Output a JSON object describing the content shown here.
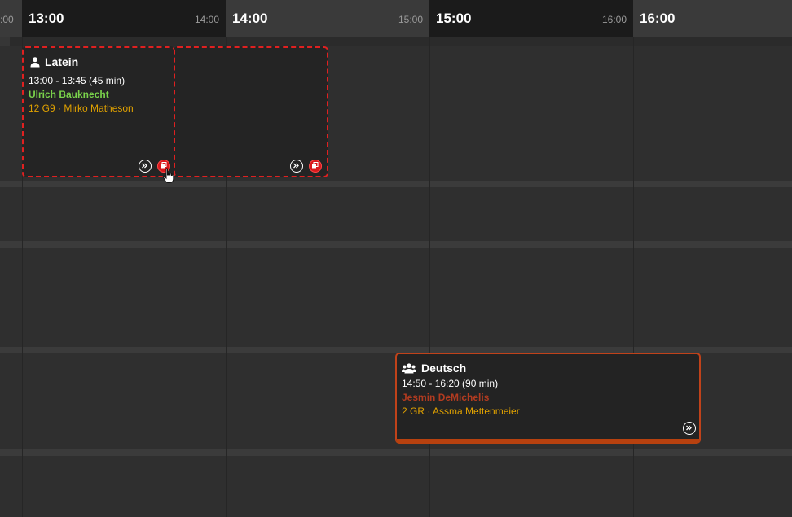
{
  "header": {
    "prev_end": ":00",
    "slots": [
      {
        "start": "13:00",
        "end": "14:00"
      },
      {
        "start": "14:00",
        "end": "15:00"
      },
      {
        "start": "15:00",
        "end": "16:00"
      },
      {
        "start": "16:00",
        "end": ""
      }
    ]
  },
  "events": {
    "latein": {
      "subject": "Latein",
      "time": "13:00 - 13:45  (45 min)",
      "teacher": "Ulrich Bauknecht",
      "group": "12 G9 · Mirko Matheson"
    },
    "deutsch": {
      "subject": "Deutsch",
      "time": "14:50 - 16:20  (90 min)",
      "teacher": "Jesmin DeMichelis",
      "group": "2 GR · Assma Mettenmeier"
    }
  },
  "colors": {
    "selection_dashed": "#e02020",
    "teacher_green": "#7ad34b",
    "teacher_red": "#b23b20",
    "group_amber": "#e0a100",
    "deutsch_accent": "#b7410f"
  },
  "icons": {
    "single_person": "person-icon",
    "group": "group-icon",
    "forward": "forward-icon",
    "copy": "copy-icon",
    "cursor": "hand-cursor-icon"
  }
}
